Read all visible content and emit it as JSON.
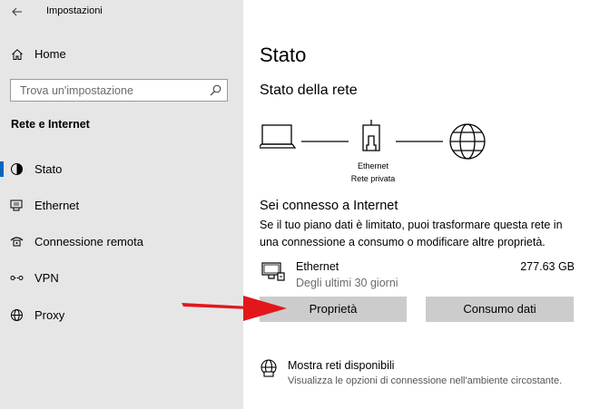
{
  "window": {
    "title": "Impostazioni"
  },
  "sidebar": {
    "home_label": "Home",
    "search_placeholder": "Trova un'impostazione",
    "section_title": "Rete e Internet",
    "items": [
      {
        "label": "Stato",
        "icon": "status-icon",
        "selected": true
      },
      {
        "label": "Ethernet",
        "icon": "ethernet-icon",
        "selected": false
      },
      {
        "label": "Connessione remota",
        "icon": "dialup-icon",
        "selected": false
      },
      {
        "label": "VPN",
        "icon": "vpn-icon",
        "selected": false
      },
      {
        "label": "Proxy",
        "icon": "globe-icon",
        "selected": false
      }
    ]
  },
  "main": {
    "title": "Stato",
    "subtitle": "Stato della rete",
    "diagram": {
      "adapter_label": "Ethernet",
      "network_label": "Rete privata"
    },
    "connection_title": "Sei connesso a Internet",
    "connection_desc": "Se il tuo piano dati è limitato, puoi trasformare questa rete in una connessione a consumo o modificare altre proprietà.",
    "adapter": {
      "name": "Ethernet",
      "period": "Degli ultimi 30 giorni",
      "usage": "277.63 GB"
    },
    "buttons": {
      "properties": "Proprietà",
      "data_usage": "Consumo dati"
    },
    "available": {
      "title": "Mostra reti disponibili",
      "desc": "Visualizza le opzioni di connessione nell'ambiente circostante."
    }
  },
  "colors": {
    "sidebar_bg": "#e6e6e6",
    "accent": "#0067c0",
    "button_bg": "#cccccc",
    "annotation_arrow": "#e3161b"
  }
}
